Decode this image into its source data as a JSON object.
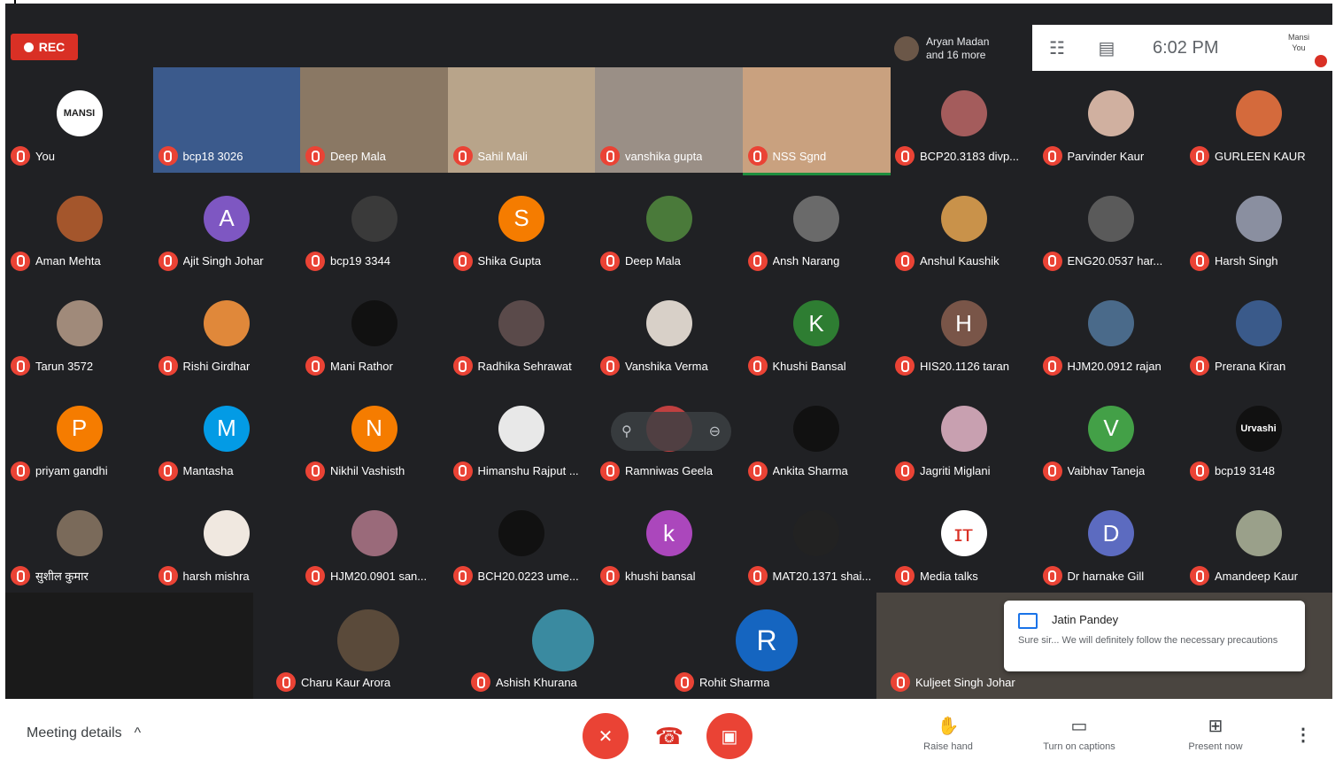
{
  "topbar": {
    "rec_label": "REC",
    "presenter_line1": "Aryan Madan",
    "presenter_line2": "and 16 more",
    "clock": "6:02 PM",
    "self_mini_line1": "Mansi",
    "self_mini_line2": "You"
  },
  "tiles": [
    {
      "name": "You",
      "avatar": "MANSI",
      "avatar_color": "#ffffff",
      "avatar_text_color": "#222222",
      "video": false
    },
    {
      "name": "bcp18 3026",
      "avatar": "",
      "avatar_color": "#3b5a8c",
      "video": true
    },
    {
      "name": "Deep Mala",
      "avatar": "",
      "avatar_color": "#8a7864",
      "video": true
    },
    {
      "name": "Sahil Mali",
      "avatar": "",
      "avatar_color": "#b8a48a",
      "video": true
    },
    {
      "name": "vanshika gupta",
      "avatar": "",
      "avatar_color": "#9a8f86",
      "video": true
    },
    {
      "name": "NSS Sgnd",
      "avatar": "",
      "avatar_color": "#c9a17f",
      "video": true,
      "speaking": true
    },
    {
      "name": "BCP20.3183 divp...",
      "avatar": "",
      "avatar_color": "#a45c5c",
      "video": false
    },
    {
      "name": "Parvinder Kaur",
      "avatar": "",
      "avatar_color": "#d0b0a0",
      "video": false
    },
    {
      "name": "GURLEEN KAUR",
      "avatar": "",
      "avatar_color": "#d46a3c",
      "video": false
    },
    {
      "name": "Aman Mehta",
      "avatar": "",
      "avatar_color": "#a4562c",
      "video": false
    },
    {
      "name": "Ajit Singh Johar",
      "avatar": "A",
      "avatar_color": "#7e57c2",
      "video": false
    },
    {
      "name": "bcp19 3344",
      "avatar": "",
      "avatar_color": "#3a3a3a",
      "video": false
    },
    {
      "name": "Shika Gupta",
      "avatar": "S",
      "avatar_color": "#f57c00",
      "video": false
    },
    {
      "name": "Deep Mala",
      "avatar": "",
      "avatar_color": "#4a7a3a",
      "video": false
    },
    {
      "name": "Ansh Narang",
      "avatar": "",
      "avatar_color": "#6a6a6a",
      "video": false
    },
    {
      "name": "Anshul Kaushik",
      "avatar": "",
      "avatar_color": "#c9924a",
      "video": false
    },
    {
      "name": "ENG20.0537 har...",
      "avatar": "",
      "avatar_color": "#5a5a5a",
      "video": false
    },
    {
      "name": "Harsh Singh",
      "avatar": "",
      "avatar_color": "#8a8fa0",
      "video": false
    },
    {
      "name": "Tarun 3572",
      "avatar": "",
      "avatar_color": "#a08a7a",
      "video": false
    },
    {
      "name": "Rishi Girdhar",
      "avatar": "",
      "avatar_color": "#e0883a",
      "video": false
    },
    {
      "name": "Mani Rathor",
      "avatar": "",
      "avatar_color": "#111111",
      "video": false
    },
    {
      "name": "Radhika Sehrawat",
      "avatar": "",
      "avatar_color": "#5a4a4a",
      "video": false
    },
    {
      "name": "Vanshika Verma",
      "avatar": "",
      "avatar_color": "#d8d0c8",
      "video": false
    },
    {
      "name": "Khushi Bansal",
      "avatar": "K",
      "avatar_color": "#2e7d32",
      "video": false
    },
    {
      "name": "HIS20.1126 taran",
      "avatar": "H",
      "avatar_color": "#795548",
      "video": false
    },
    {
      "name": "HJM20.0912 rajan",
      "avatar": "",
      "avatar_color": "#4a6a8a",
      "video": false
    },
    {
      "name": "Prerana Kiran",
      "avatar": "",
      "avatar_color": "#3a5a8a",
      "video": false
    },
    {
      "name": "priyam gandhi",
      "avatar": "P",
      "avatar_color": "#f57c00",
      "video": false
    },
    {
      "name": "Mantasha",
      "avatar": "M",
      "avatar_color": "#039be5",
      "video": false
    },
    {
      "name": "Nikhil Vashisth",
      "avatar": "N",
      "avatar_color": "#f57c00",
      "video": false
    },
    {
      "name": "Himanshu Rajput ...",
      "avatar": "",
      "avatar_color": "#e8e8e8",
      "video": false
    },
    {
      "name": "Ramniwas Geela",
      "avatar": "",
      "avatar_color": "#c04040",
      "video": false,
      "hover": true
    },
    {
      "name": "Ankita Sharma",
      "avatar": "",
      "avatar_color": "#111111",
      "video": false
    },
    {
      "name": "Jagriti Miglani",
      "avatar": "",
      "avatar_color": "#c8a0b0",
      "video": false
    },
    {
      "name": "Vaibhav Taneja",
      "avatar": "V",
      "avatar_color": "#43a047",
      "video": false
    },
    {
      "name": "bcp19 3148",
      "avatar": "Urvashi",
      "avatar_color": "#111111",
      "video": false
    },
    {
      "name": "सुशील कुमार",
      "avatar": "",
      "avatar_color": "#7a6a5a",
      "video": false
    },
    {
      "name": "harsh mishra",
      "avatar": "",
      "avatar_color": "#f0e8e0",
      "video": false
    },
    {
      "name": "HJM20.0901 san...",
      "avatar": "",
      "avatar_color": "#9a6a7a",
      "video": false
    },
    {
      "name": "BCH20.0223 ume...",
      "avatar": "",
      "avatar_color": "#111111",
      "video": false
    },
    {
      "name": "khushi bansal",
      "avatar": "k",
      "avatar_color": "#ab47bc",
      "video": false
    },
    {
      "name": "MAT20.1371 shai...",
      "avatar": "",
      "avatar_color": "#222222",
      "video": false
    },
    {
      "name": "Media talks",
      "avatar": "ɪᴛ",
      "avatar_color": "#ffffff",
      "avatar_text_color": "#d93025",
      "video": false
    },
    {
      "name": "Dr harnake Gill",
      "avatar": "D",
      "avatar_color": "#5c6bc0",
      "video": false
    },
    {
      "name": "Amandeep Kaur",
      "avatar": "",
      "avatar_color": "#9aa08a",
      "video": false
    }
  ],
  "bottom_tiles": [
    {
      "name": "Charu Kaur Arora",
      "avatar": "",
      "avatar_color": "#5a4a3a"
    },
    {
      "name": "Ashish Khurana",
      "avatar": "",
      "avatar_color": "#3a8aa0"
    },
    {
      "name": "Rohit Sharma",
      "avatar": "R",
      "avatar_color": "#1565c0"
    }
  ],
  "pinned_tile": {
    "name": "Kuljeet Singh Johar"
  },
  "toast": {
    "sender": "Jatin Pandey",
    "message": "Sure sir... We will definitely follow the necessary precautions"
  },
  "controls": {
    "meeting_details": "Meeting details",
    "chevron": "^",
    "raise_hand": "Raise hand",
    "captions": "Turn on captions",
    "present": "Present now",
    "more": "⋮"
  }
}
